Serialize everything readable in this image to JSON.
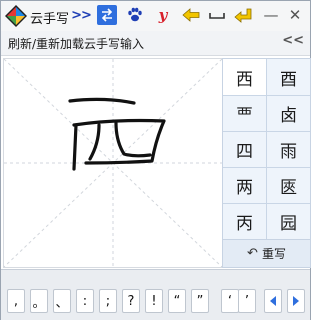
{
  "window": {
    "title": "云手写",
    "min_label": "—",
    "close_label": "✕"
  },
  "toolbar": {
    "expand_label": ">>",
    "swap_label": "⇆",
    "y_label": "y",
    "collapse_label": "<<"
  },
  "subbar": {
    "refresh_text": "刷新/重新加载云手写输入"
  },
  "candidates": [
    {
      "char": "西",
      "selected": true
    },
    {
      "char": "酉",
      "selected": false
    },
    {
      "char": "覀",
      "selected": false
    },
    {
      "char": "卤",
      "selected": false
    },
    {
      "char": "四",
      "selected": false
    },
    {
      "char": "雨",
      "selected": false
    },
    {
      "char": "两",
      "selected": false
    },
    {
      "char": "匧",
      "selected": false
    },
    {
      "char": "丙",
      "selected": false
    },
    {
      "char": "园",
      "selected": false
    }
  ],
  "rewrite": {
    "label": "重写",
    "icon": "↶"
  },
  "punctuation": [
    ",",
    "。",
    "、",
    ":",
    ";",
    "?",
    "!",
    "“",
    "”",
    "‘",
    "’"
  ],
  "colors": {
    "accent_blue": "#2f6fde",
    "arrow_yellow": "#f2c500",
    "y_red": "#d8202b"
  }
}
